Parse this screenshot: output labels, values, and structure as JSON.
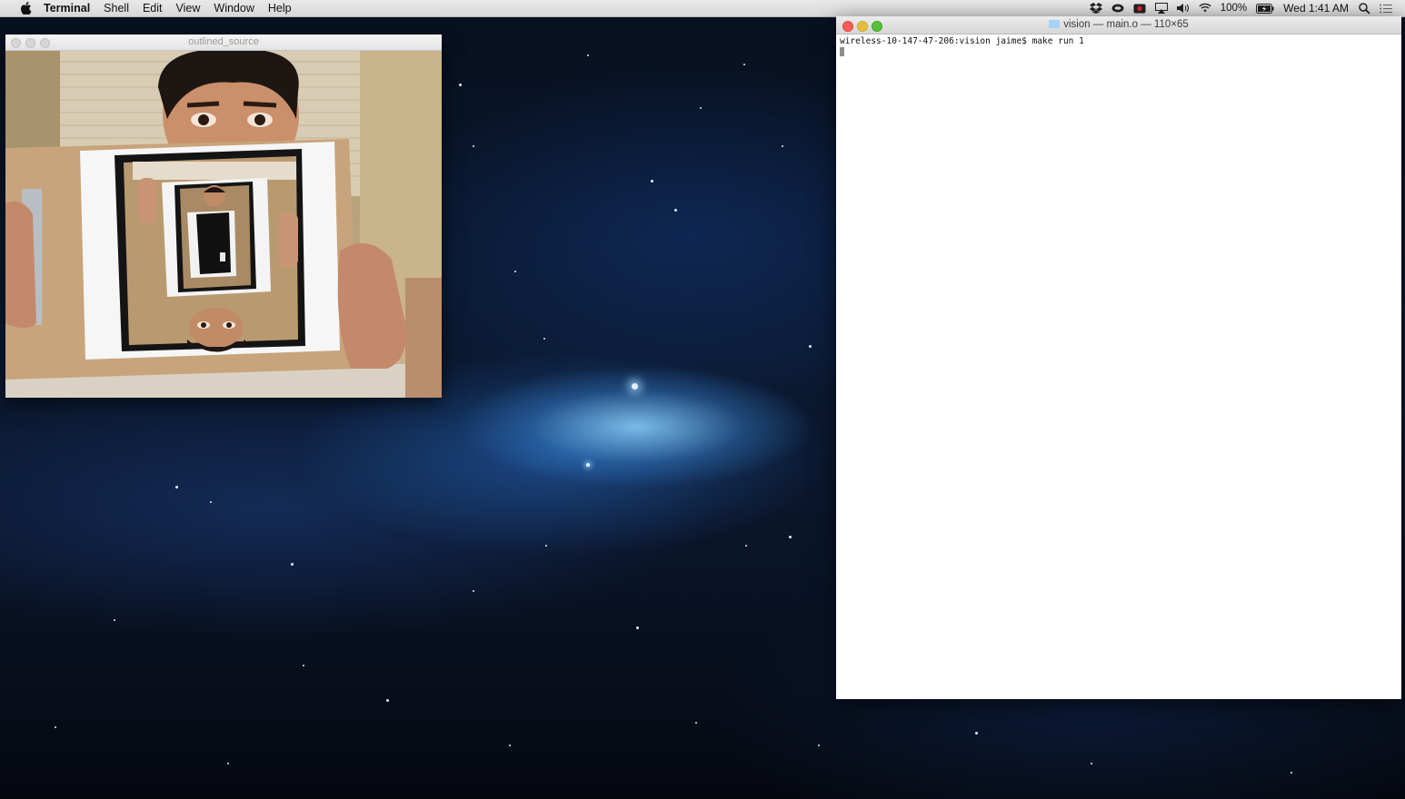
{
  "menubar": {
    "app_name": "Terminal",
    "menus": [
      "Shell",
      "Edit",
      "View",
      "Window",
      "Help"
    ],
    "status": {
      "battery": "100%",
      "clock": "Wed 1:41 AM"
    },
    "icons": [
      "apple-icon",
      "dropbox-icon",
      "cloud-app-icon",
      "record-icon",
      "airplay-icon",
      "volume-icon",
      "wifi-icon",
      "battery-icon",
      "spotlight-icon",
      "notification-center-icon"
    ]
  },
  "camera_window": {
    "title": "outlined_source"
  },
  "terminal_window": {
    "title": "vision — main.o — 110×65",
    "lines": [
      "wireless-10-147-47-206:vision jaime$ make run 1"
    ]
  },
  "colors": {
    "menubar": "#dcdcdc",
    "close_red": "#fc5b57",
    "minimize_yellow": "#e5bf3c",
    "zoom_green": "#57c038",
    "desktop_dark": "#07101f",
    "nebula_blue": "#3c8cdc"
  }
}
